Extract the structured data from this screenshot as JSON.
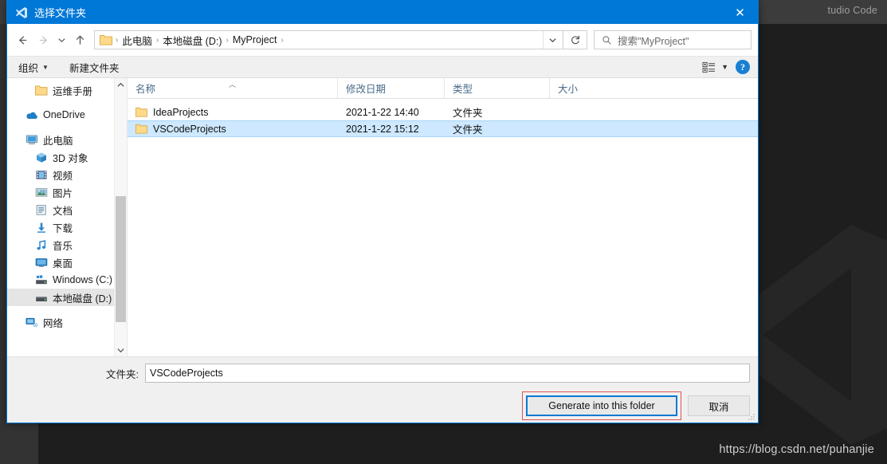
{
  "background": {
    "app_title": "tudio Code",
    "watermark_url": "https://blog.csdn.net/puhanjie",
    "logo_icon": "vscode-logo-watermark"
  },
  "dialog": {
    "titlebar": {
      "icon": "vscode-icon",
      "title": "选择文件夹",
      "close_label": "✕"
    },
    "address": {
      "back_icon": "arrow-left-icon",
      "forward_icon": "arrow-right-icon",
      "recent_icon": "chevron-down-icon",
      "up_icon": "arrow-up-icon",
      "folder_icon": "folder-icon",
      "crumbs": [
        "此电脑",
        "本地磁盘 (D:)",
        "MyProject"
      ],
      "separator": "›",
      "dropdown_icon": "chevron-down-icon",
      "refresh_icon": "refresh-icon",
      "search_icon": "search-icon",
      "search_placeholder": "搜索\"MyProject\""
    },
    "toolbar": {
      "organize_label": "组织",
      "organize_caret": "▼",
      "new_folder_label": "新建文件夹",
      "view_icon": "view-options-icon",
      "view_caret": "▼",
      "help_label": "?",
      "help_icon": "help-icon"
    },
    "nav_pane": {
      "items": [
        {
          "label": "运维手册",
          "icon": "folder-icon",
          "indent": true,
          "selected": false
        },
        {
          "label": "OneDrive",
          "icon": "onedrive-icon",
          "indent": false,
          "selected": false,
          "gap_before": true
        },
        {
          "label": "此电脑",
          "icon": "this-pc-icon",
          "indent": false,
          "selected": false,
          "gap_before": true
        },
        {
          "label": "3D 对象",
          "icon": "3d-objects-icon",
          "indent": true,
          "selected": false
        },
        {
          "label": "视频",
          "icon": "videos-icon",
          "indent": true,
          "selected": false
        },
        {
          "label": "图片",
          "icon": "pictures-icon",
          "indent": true,
          "selected": false
        },
        {
          "label": "文档",
          "icon": "documents-icon",
          "indent": true,
          "selected": false
        },
        {
          "label": "下载",
          "icon": "downloads-icon",
          "indent": true,
          "selected": false
        },
        {
          "label": "音乐",
          "icon": "music-icon",
          "indent": true,
          "selected": false
        },
        {
          "label": "桌面",
          "icon": "desktop-icon",
          "indent": true,
          "selected": false
        },
        {
          "label": "Windows (C:)",
          "icon": "drive-windows-icon",
          "indent": true,
          "selected": false
        },
        {
          "label": "本地磁盘 (D:)",
          "icon": "drive-icon",
          "indent": true,
          "selected": true
        },
        {
          "label": "网络",
          "icon": "network-icon",
          "indent": false,
          "selected": false,
          "gap_before": true
        }
      ],
      "scroll_up_icon": "chevron-up-icon",
      "scroll_down_icon": "chevron-down-icon"
    },
    "file_list": {
      "columns": [
        "名称",
        "修改日期",
        "类型",
        "大小"
      ],
      "sort_indicator": "︿",
      "rows": [
        {
          "name": "IdeaProjects",
          "date": "2021-1-22 14:40",
          "type": "文件夹",
          "size": "",
          "selected": false,
          "icon": "folder-icon"
        },
        {
          "name": "VSCodeProjects",
          "date": "2021-1-22 15:12",
          "type": "文件夹",
          "size": "",
          "selected": true,
          "icon": "folder-icon"
        }
      ]
    },
    "footer": {
      "folder_label": "文件夹:",
      "folder_value": "VSCodeProjects",
      "confirm_label": "Generate into this folder",
      "cancel_label": "取消",
      "resize_grip_icon": "resize-grip-icon"
    }
  },
  "colors": {
    "accent": "#0078d7",
    "selection": "#cde8ff",
    "annotation": "#e05555",
    "focus_border": "#0b7ad1"
  }
}
